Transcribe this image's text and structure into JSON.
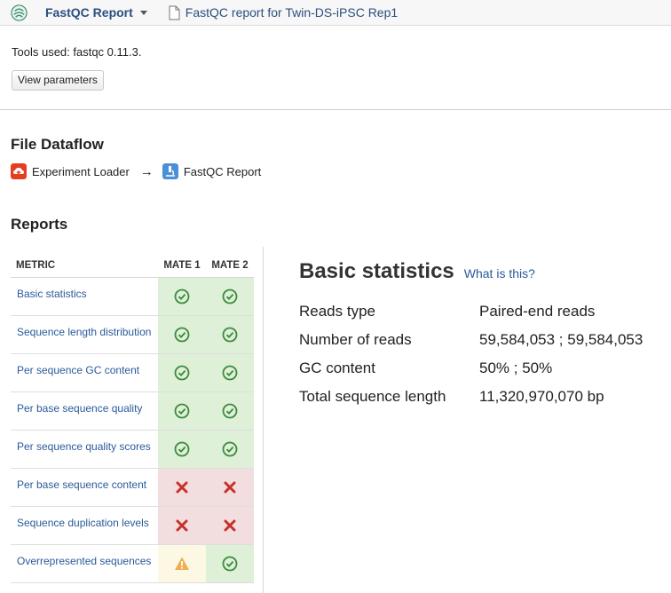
{
  "topbar": {
    "app_title": "FastQC Report",
    "doc_title": "FastQC report for Twin-DS-iPSC Rep1"
  },
  "tools": {
    "text": "Tools used: fastqc 0.11.3.",
    "view_params_label": "View parameters"
  },
  "dataflow": {
    "heading": "File Dataflow",
    "source": "Experiment Loader",
    "arrow": "→",
    "target": "FastQC Report"
  },
  "reports": {
    "heading": "Reports",
    "columns": [
      "METRIC",
      "MATE 1",
      "MATE 2"
    ],
    "rows": [
      {
        "metric": "Basic statistics",
        "mate1": "pass",
        "mate2": "pass"
      },
      {
        "metric": "Sequence length distribution",
        "mate1": "pass",
        "mate2": "pass"
      },
      {
        "metric": "Per sequence GC content",
        "mate1": "pass",
        "mate2": "pass"
      },
      {
        "metric": "Per base sequence quality",
        "mate1": "pass",
        "mate2": "pass"
      },
      {
        "metric": "Per sequence quality scores",
        "mate1": "pass",
        "mate2": "pass"
      },
      {
        "metric": "Per base sequence content",
        "mate1": "fail",
        "mate2": "fail"
      },
      {
        "metric": "Sequence duplication levels",
        "mate1": "fail",
        "mate2": "fail"
      },
      {
        "metric": "Overrepresented sequences",
        "mate1": "warn",
        "mate2": "pass"
      }
    ]
  },
  "basic_stats": {
    "title": "Basic statistics",
    "help_link": "What is this?",
    "rows": [
      {
        "label": "Reads type",
        "value": "Paired-end reads"
      },
      {
        "label": "Number of reads",
        "value": "59,584,053 ; 59,584,053"
      },
      {
        "label": "GC content",
        "value": "50% ; 50%"
      },
      {
        "label": "Total sequence length",
        "value": "11,320,970,070 bp"
      }
    ]
  },
  "colors": {
    "pass_bg": "#dff0d8",
    "fail_bg": "#f2dede",
    "warn_bg": "#fcf8e3",
    "pass_icon": "#3c8b3c",
    "fail_icon": "#c9302c",
    "warn_icon": "#f0ad4e",
    "link": "#2a5a9a"
  },
  "icons": {
    "pass": "check-circle-icon",
    "fail": "cross-icon",
    "warn": "warning-triangle-icon"
  }
}
